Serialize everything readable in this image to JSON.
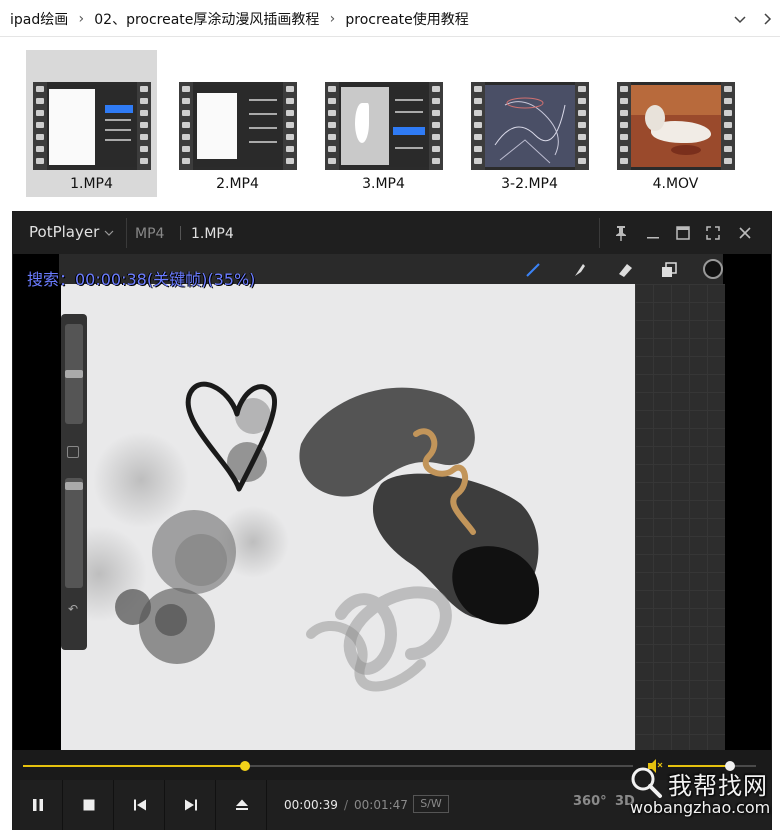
{
  "breadcrumb": {
    "items": [
      "ipad绘画",
      "02、procreate厚涂动漫风插画教程",
      "procreate使用教程"
    ],
    "separator_icon": "chevron-right-icon"
  },
  "files": [
    {
      "name": "1.MP4",
      "selected": true
    },
    {
      "name": "2.MP4",
      "selected": false
    },
    {
      "name": "3.MP4",
      "selected": false
    },
    {
      "name": "3-2.MP4",
      "selected": false
    },
    {
      "name": "4.MOV",
      "selected": false
    }
  ],
  "player": {
    "brand": "PotPlayer",
    "format": "MP4",
    "title": "1.MP4",
    "osd_text": "搜索：00:00:38(关键帧)(35%)",
    "time_current": "00:00:39",
    "time_separator": "/",
    "time_total": "00:01:47",
    "sw_label": "S/W",
    "extra_labels": [
      "360°",
      "3D"
    ],
    "progress_fraction": 0.364,
    "volume_fraction": 0.7,
    "accent_color": "#e6c20e",
    "osd_color": "#6b7cff"
  },
  "watermark": {
    "cn": "我帮找网",
    "en": "wobangzhao.com"
  }
}
